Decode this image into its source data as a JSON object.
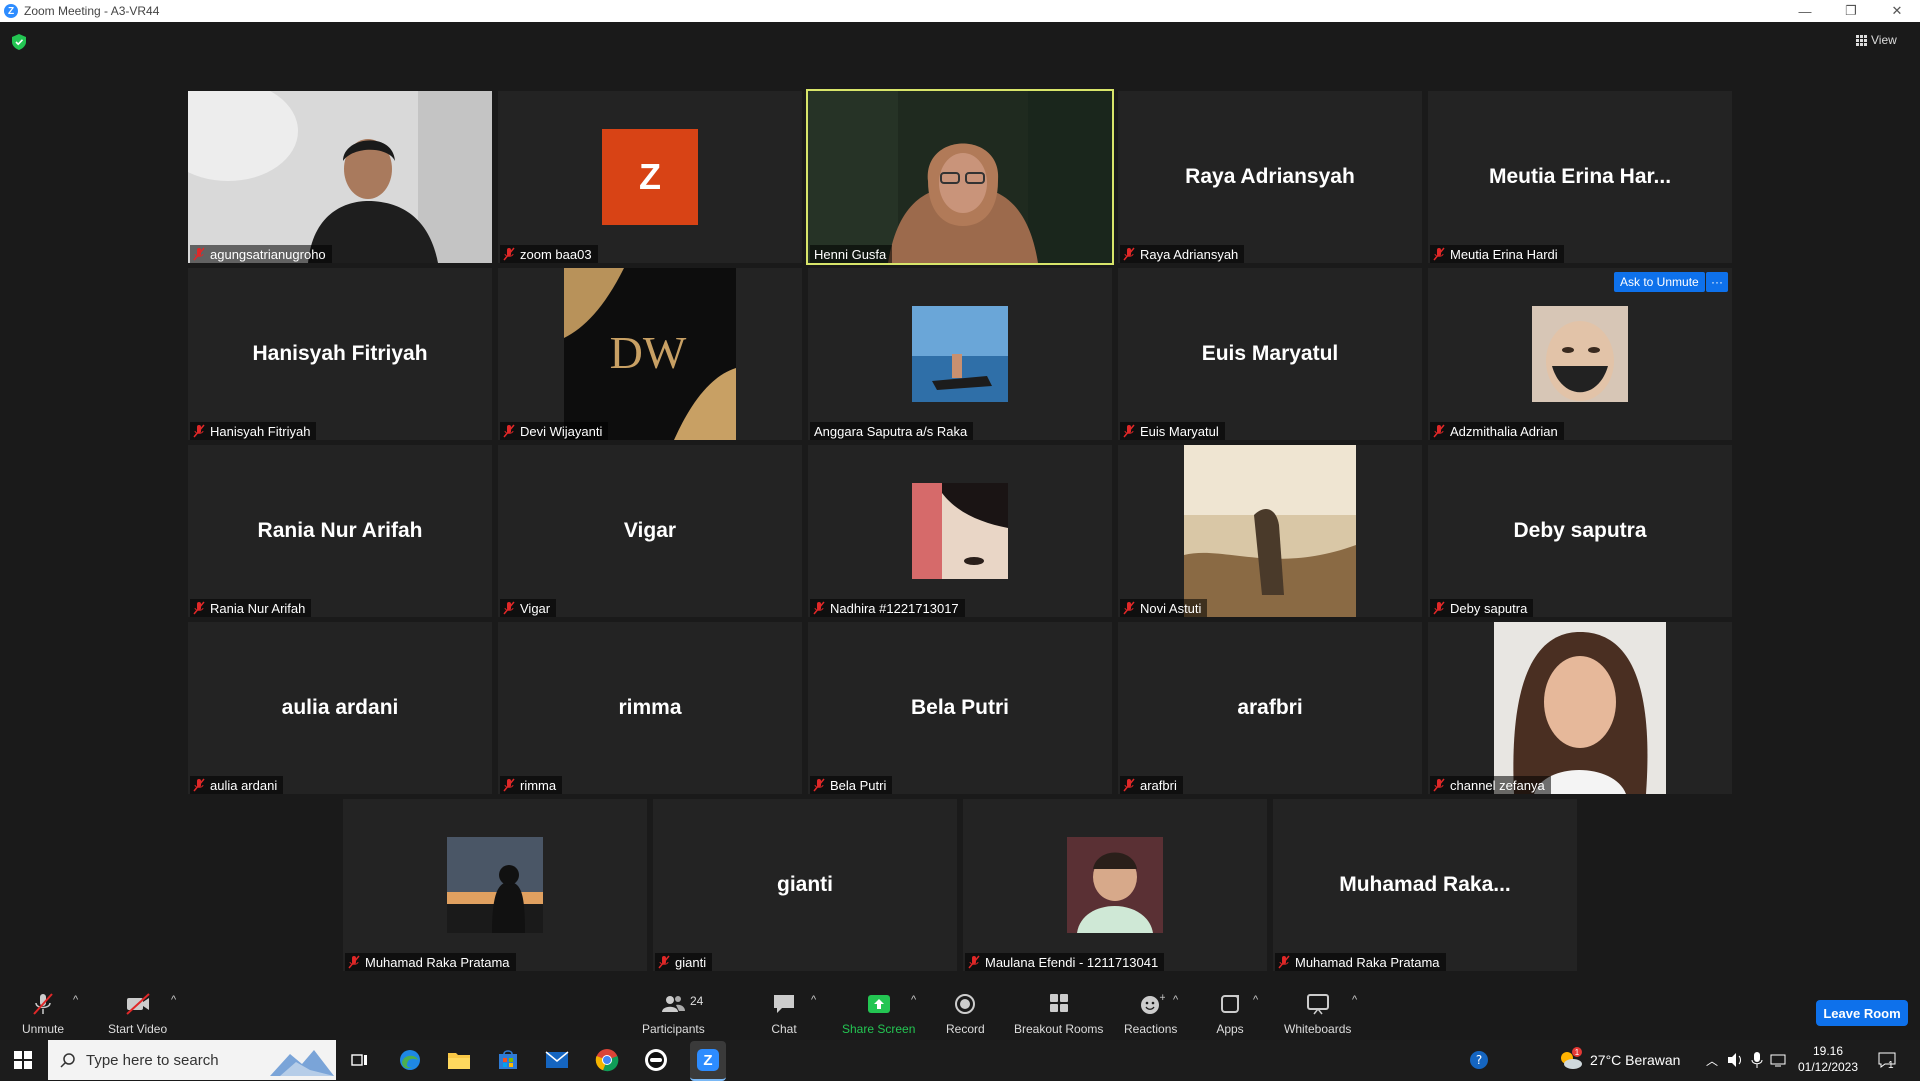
{
  "window": {
    "title": "Zoom Meeting - A3-VR44",
    "minimize": "—",
    "maximize": "❐",
    "close": "✕"
  },
  "top": {
    "view_label": "View"
  },
  "tiles": {
    "t1": {
      "label": "agungsatrianugroho"
    },
    "t2": {
      "label": "zoom baa03",
      "avatar_letter": "Z"
    },
    "t3": {
      "label": "Henni Gusfa"
    },
    "t4": {
      "big": "Raya Adriansyah",
      "label": "Raya Adriansyah"
    },
    "t5": {
      "big": "Meutia Erina Har...",
      "label": "Meutia Erina Hardi"
    },
    "t6": {
      "big": "Hanisyah Fitriyah",
      "label": "Hanisyah Fitriyah"
    },
    "t7": {
      "label": "Devi Wijayanti",
      "logo_text": "DW"
    },
    "t8": {
      "label": "Anggara Saputra a/s Raka"
    },
    "t9": {
      "big": "Euis Maryatul",
      "label": "Euis Maryatul"
    },
    "t10": {
      "label": "Adzmithalia Adrian",
      "ask_unmute": "Ask to Unmute",
      "more": "···"
    },
    "t11": {
      "big": "Rania Nur Arifah",
      "label": "Rania Nur Arifah"
    },
    "t12": {
      "big": "Vigar",
      "label": "Vigar"
    },
    "t13": {
      "label": "Nadhira #1221713017"
    },
    "t14": {
      "label": "Novi Astuti"
    },
    "t15": {
      "big": "Deby saputra",
      "label": "Deby saputra"
    },
    "t16": {
      "big": "aulia ardani",
      "label": "aulia ardani"
    },
    "t17": {
      "big": "rimma",
      "label": "rimma"
    },
    "t18": {
      "big": "Bela Putri",
      "label": "Bela Putri"
    },
    "t19": {
      "big": "arafbri",
      "label": "arafbri"
    },
    "t20": {
      "label": "channel zefanya"
    },
    "t21": {
      "label": "Muhamad Raka Pratama"
    },
    "t22": {
      "big": "gianti",
      "label": "gianti"
    },
    "t23": {
      "label": "Maulana Efendi - 1211713041"
    },
    "t24": {
      "big": "Muhamad  Raka...",
      "label": "Muhamad Raka Pratama"
    }
  },
  "toolbar": {
    "unmute": "Unmute",
    "start_video": "Start Video",
    "participants": "Participants",
    "participants_count": "24",
    "chat": "Chat",
    "share_screen": "Share Screen",
    "record": "Record",
    "breakout_rooms": "Breakout Rooms",
    "reactions": "Reactions",
    "apps": "Apps",
    "whiteboards": "Whiteboards",
    "leave": "Leave Room",
    "caret": "^"
  },
  "taskbar": {
    "search_placeholder": "Type here to search",
    "weather": "27°C  Berawan",
    "time": "19.16",
    "date": "01/12/2023",
    "notif_count": "1",
    "weather_badge": "1"
  },
  "colors": {
    "accent": "#0e71eb",
    "active_speaker": "#d8e56a",
    "muted_red": "#e02828",
    "share_green": "#23c552",
    "avatar_orange": "#d84315"
  }
}
